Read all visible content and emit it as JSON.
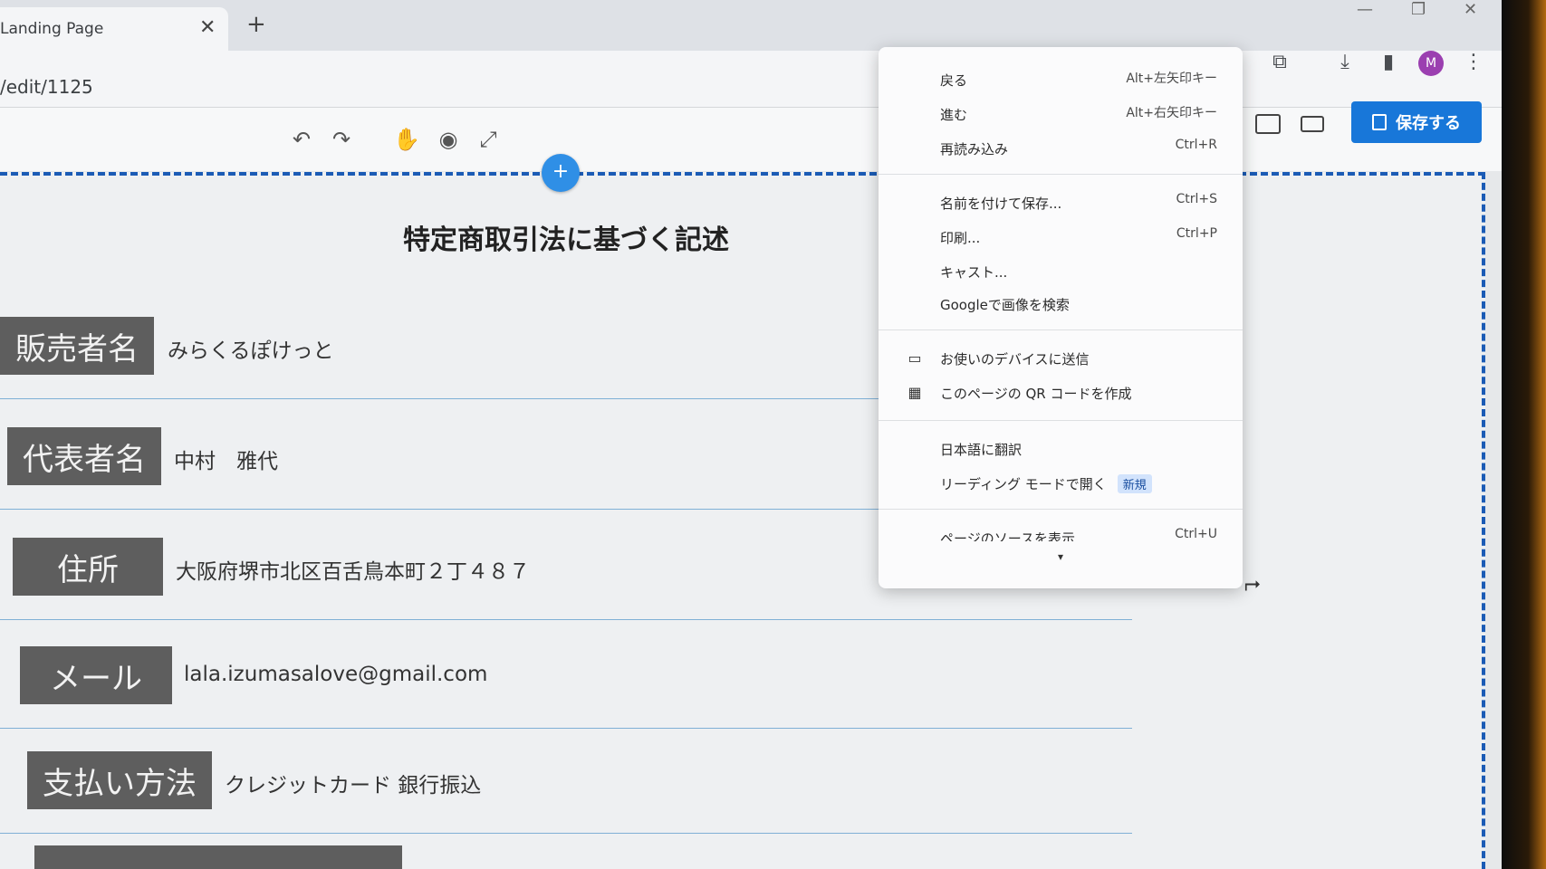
{
  "browser": {
    "tab_title": "Landing Page",
    "tab_close": "✕",
    "new_tab": "+",
    "url": "/edit/1125",
    "avatar_letter": "M"
  },
  "editor": {
    "save_label": "保存する",
    "add_section": "+"
  },
  "page": {
    "section_title": "特定商取引法に基づく記述",
    "rows": [
      {
        "label": "販売者名",
        "value": "みらくるぽけっと"
      },
      {
        "label": "代表者名",
        "value": "中村　雅代"
      },
      {
        "label": "住所",
        "value": "大阪府堺市北区百舌鳥本町２丁４８７"
      },
      {
        "label": "メール",
        "value": "lala.izumasalove@gmail.com"
      },
      {
        "label": "支払い方法",
        "value": "クレジットカード 銀行振込"
      }
    ]
  },
  "context_menu": {
    "items": [
      {
        "label": "戻る",
        "shortcut": "Alt+左矢印キー"
      },
      {
        "label": "進む",
        "shortcut": "Alt+右矢印キー"
      },
      {
        "label": "再読み込み",
        "shortcut": "Ctrl+R"
      },
      {
        "label": "名前を付けて保存...",
        "shortcut": "Ctrl+S"
      },
      {
        "label": "印刷...",
        "shortcut": "Ctrl+P"
      },
      {
        "label": "キャスト...",
        "shortcut": ""
      },
      {
        "label": "Googleで画像を検索",
        "shortcut": ""
      },
      {
        "label": "お使いのデバイスに送信",
        "shortcut": ""
      },
      {
        "label": "このページの QR コードを作成",
        "shortcut": ""
      },
      {
        "label": "日本語に翻訳",
        "shortcut": ""
      },
      {
        "label": "リーディング モードで開く",
        "shortcut": "",
        "badge": "新規"
      },
      {
        "label": "ページのソースを表示",
        "shortcut": "Ctrl+U"
      }
    ]
  }
}
